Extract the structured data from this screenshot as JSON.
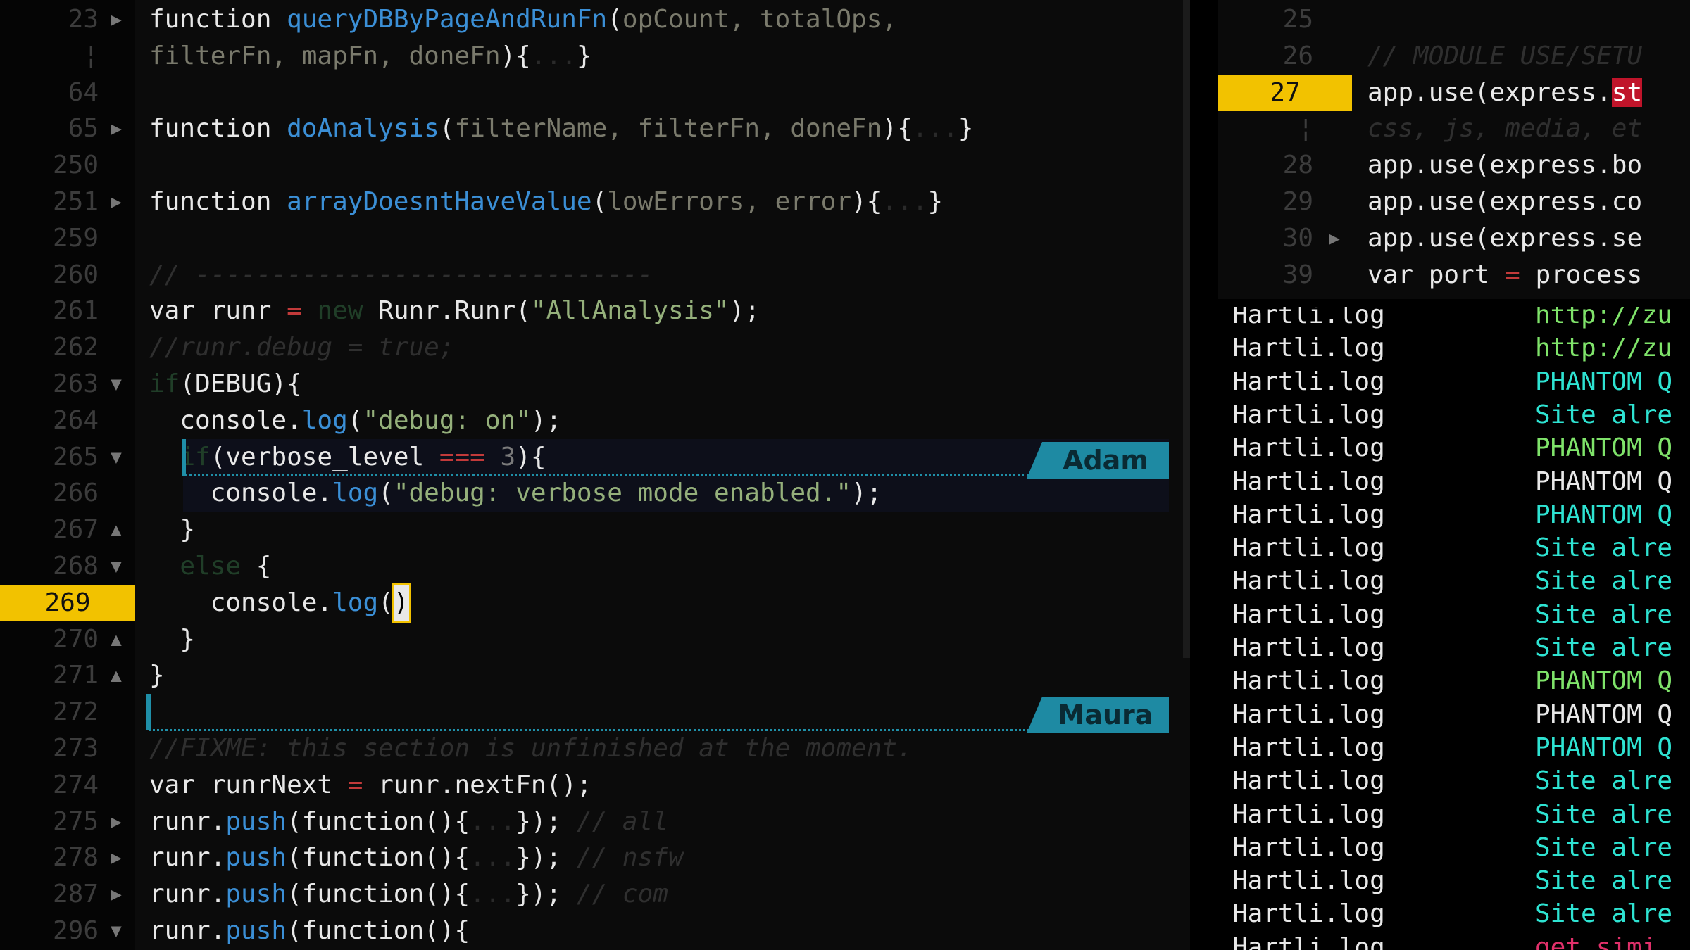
{
  "editor": {
    "lines": [
      {
        "num": "23",
        "fold": "right",
        "tokens": [
          [
            "kw",
            "function "
          ],
          [
            "fn",
            "queryDBByPageAndRunFn"
          ],
          [
            "kw",
            "("
          ],
          [
            "prm",
            "opCount, totalOps,"
          ]
        ]
      },
      {
        "num": "¦",
        "fold": "",
        "tokens": [
          [
            "prm",
            "filterFn, mapFn, doneFn"
          ],
          [
            "kw",
            "){"
          ],
          [
            "dim",
            "..."
          ],
          [
            "kw",
            "}"
          ]
        ]
      },
      {
        "num": "64",
        "fold": "",
        "tokens": []
      },
      {
        "num": "65",
        "fold": "right",
        "tokens": [
          [
            "kw",
            "function "
          ],
          [
            "fn",
            "doAnalysis"
          ],
          [
            "kw",
            "("
          ],
          [
            "prm",
            "filterName, filterFn, doneFn"
          ],
          [
            "kw",
            "){"
          ],
          [
            "dim",
            "..."
          ],
          [
            "kw",
            "}"
          ]
        ]
      },
      {
        "num": "250",
        "fold": "",
        "tokens": []
      },
      {
        "num": "251",
        "fold": "right",
        "tokens": [
          [
            "kw",
            "function "
          ],
          [
            "fn",
            "arrayDoesntHaveValue"
          ],
          [
            "kw",
            "("
          ],
          [
            "prm",
            "lowErrors, error"
          ],
          [
            "kw",
            "){"
          ],
          [
            "dim",
            "..."
          ],
          [
            "kw",
            "}"
          ]
        ]
      },
      {
        "num": "259",
        "fold": "",
        "tokens": []
      },
      {
        "num": "260",
        "fold": "",
        "tokens": [
          [
            "cm",
            "// ------------------------------"
          ]
        ]
      },
      {
        "num": "261",
        "fold": "",
        "tokens": [
          [
            "kw",
            "var runr "
          ],
          [
            "op",
            "= "
          ],
          [
            "nw",
            "new "
          ],
          [
            "kw",
            "Runr.Runr("
          ],
          [
            "str",
            "\"AllAnalysis\""
          ],
          [
            "kw",
            ");"
          ]
        ]
      },
      {
        "num": "262",
        "fold": "",
        "tokens": [
          [
            "cm",
            "//runr.debug = true;"
          ]
        ]
      },
      {
        "num": "263",
        "fold": "down",
        "tokens": [
          [
            "nw",
            "if"
          ],
          [
            "kw",
            "(DEBUG){"
          ]
        ]
      },
      {
        "num": "264",
        "fold": "",
        "tokens": [
          [
            "kw",
            "  console."
          ],
          [
            "fn",
            "log"
          ],
          [
            "kw",
            "("
          ],
          [
            "str",
            "\"debug: on\""
          ],
          [
            "kw",
            ");"
          ]
        ]
      },
      {
        "num": "265",
        "fold": "down",
        "tokens": [
          [
            "nw",
            "  if"
          ],
          [
            "kw",
            "(verbose_level "
          ],
          [
            "op",
            "=== "
          ],
          [
            "num",
            "3"
          ],
          [
            "kw",
            "){"
          ]
        ]
      },
      {
        "num": "266",
        "fold": "",
        "tokens": [
          [
            "kw",
            "    console."
          ],
          [
            "fn",
            "log"
          ],
          [
            "kw",
            "("
          ],
          [
            "str",
            "\"debug: verbose mode enabled.\""
          ],
          [
            "kw",
            ");"
          ]
        ]
      },
      {
        "num": "267",
        "fold": "up",
        "tokens": [
          [
            "kw",
            "  }"
          ]
        ]
      },
      {
        "num": "268",
        "fold": "down",
        "tokens": [
          [
            "nw",
            "  else "
          ],
          [
            "kw",
            "{"
          ]
        ]
      },
      {
        "num": "269",
        "fold": "",
        "current": true,
        "tokens": [
          [
            "kw",
            "    console."
          ],
          [
            "fn",
            "log"
          ],
          [
            "kw",
            "("
          ],
          [
            "cursor",
            ")"
          ]
        ]
      },
      {
        "num": "270",
        "fold": "up",
        "tokens": [
          [
            "kw",
            "  }"
          ]
        ]
      },
      {
        "num": "271",
        "fold": "up",
        "tokens": [
          [
            "kw",
            "}"
          ]
        ]
      },
      {
        "num": "272",
        "fold": "",
        "tokens": []
      },
      {
        "num": "273",
        "fold": "",
        "tokens": [
          [
            "cm",
            "//FIXME: this section is unfinished at the moment."
          ]
        ]
      },
      {
        "num": "274",
        "fold": "",
        "tokens": [
          [
            "kw",
            "var runrNext "
          ],
          [
            "op",
            "= "
          ],
          [
            "kw",
            "runr.nextFn();"
          ]
        ]
      },
      {
        "num": "275",
        "fold": "right",
        "tokens": [
          [
            "kw",
            "runr."
          ],
          [
            "fn",
            "push"
          ],
          [
            "kw",
            "(function(){"
          ],
          [
            "dim",
            "..."
          ],
          [
            "kw",
            "}); "
          ],
          [
            "cm",
            "// all"
          ]
        ]
      },
      {
        "num": "278",
        "fold": "right",
        "tokens": [
          [
            "kw",
            "runr."
          ],
          [
            "fn",
            "push"
          ],
          [
            "kw",
            "(function(){"
          ],
          [
            "dim",
            "..."
          ],
          [
            "kw",
            "}); "
          ],
          [
            "cm",
            "// nsfw"
          ]
        ]
      },
      {
        "num": "287",
        "fold": "right",
        "tokens": [
          [
            "kw",
            "runr."
          ],
          [
            "fn",
            "push"
          ],
          [
            "kw",
            "(function(){"
          ],
          [
            "dim",
            "..."
          ],
          [
            "kw",
            "}); "
          ],
          [
            "cm",
            "// com"
          ]
        ]
      },
      {
        "num": "296",
        "fold": "down",
        "tokens": [
          [
            "kw",
            "runr."
          ],
          [
            "fn",
            "push"
          ],
          [
            "kw",
            "(function(){"
          ]
        ]
      }
    ],
    "collaborators": [
      {
        "name": "Adam",
        "row": 12
      },
      {
        "name": "Maura",
        "row": 19
      }
    ]
  },
  "split_pane": {
    "lines": [
      {
        "num": "25",
        "fold": "",
        "tokens": []
      },
      {
        "num": "26",
        "fold": "",
        "tokens": [
          [
            "cm",
            "// MODULE USE/SETU"
          ]
        ]
      },
      {
        "num": "27",
        "fold": "",
        "current": true,
        "tokens": [
          [
            "kw",
            "app.use(express."
          ],
          [
            "red",
            "st"
          ]
        ]
      },
      {
        "num": "¦",
        "fold": "",
        "tokens": [
          [
            "cm",
            "css, js, media, et"
          ]
        ]
      },
      {
        "num": "28",
        "fold": "",
        "tokens": [
          [
            "kw",
            "app.use(express.bo"
          ]
        ]
      },
      {
        "num": "29",
        "fold": "",
        "tokens": [
          [
            "kw",
            "app.use(express.co"
          ]
        ]
      },
      {
        "num": "30",
        "fold": "right",
        "tokens": [
          [
            "kw",
            "app.use(express.se"
          ]
        ]
      },
      {
        "num": "39",
        "fold": "",
        "tokens": [
          [
            "kw",
            "var port "
          ],
          [
            "op",
            "= "
          ],
          [
            "kw",
            "process"
          ]
        ]
      }
    ]
  },
  "terminal": {
    "rows": [
      {
        "file": "Hartli.log",
        "msg": "http://zu",
        "color": "#7fe36a"
      },
      {
        "file": "Hartli.log",
        "msg": "http://zu",
        "color": "#7fe36a"
      },
      {
        "file": "Hartli.log",
        "msg": "PHANTOM Q",
        "color": "#2ee3d2"
      },
      {
        "file": "Hartli.log",
        "msg": "Site alre",
        "color": "#2ee3d2"
      },
      {
        "file": "Hartli.log",
        "msg": "PHANTOM Q",
        "color": "#7fe36a"
      },
      {
        "file": "Hartli.log",
        "msg": "PHANTOM Q",
        "color": "#e8e8e8"
      },
      {
        "file": "Hartli.log",
        "msg": "PHANTOM Q",
        "color": "#2ee3d2"
      },
      {
        "file": "Hartli.log",
        "msg": "Site alre",
        "color": "#2ee3d2"
      },
      {
        "file": "Hartli.log",
        "msg": "Site alre",
        "color": "#2ee3d2"
      },
      {
        "file": "Hartli.log",
        "msg": "Site alre",
        "color": "#2ee3d2"
      },
      {
        "file": "Hartli.log",
        "msg": "Site alre",
        "color": "#2ee3d2"
      },
      {
        "file": "Hartli.log",
        "msg": "PHANTOM Q",
        "color": "#7fe36a"
      },
      {
        "file": "Hartli.log",
        "msg": "PHANTOM Q",
        "color": "#e8e8e8"
      },
      {
        "file": "Hartli.log",
        "msg": "PHANTOM Q",
        "color": "#2ee3d2"
      },
      {
        "file": "Hartli.log",
        "msg": "Site alre",
        "color": "#2ee3d2"
      },
      {
        "file": "Hartli.log",
        "msg": "Site alre",
        "color": "#2ee3d2"
      },
      {
        "file": "Hartli.log",
        "msg": "Site alre",
        "color": "#2ee3d2"
      },
      {
        "file": "Hartli.log",
        "msg": "Site alre",
        "color": "#2ee3d2"
      },
      {
        "file": "Hartli.log",
        "msg": "Site alre",
        "color": "#2ee3d2"
      },
      {
        "file": "Hartli.log",
        "msg": "get simi",
        "color": "#e0306a"
      }
    ]
  }
}
